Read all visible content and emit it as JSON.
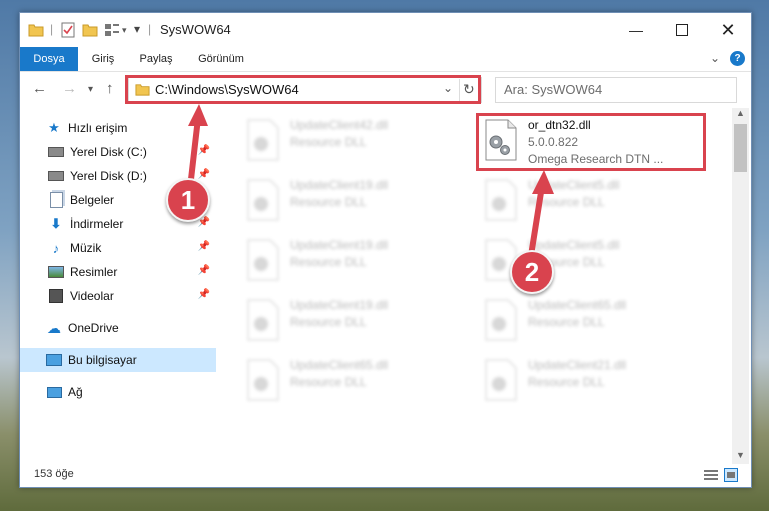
{
  "window": {
    "title": "SysWOW64"
  },
  "ribbon": {
    "tabs": [
      "Dosya",
      "Giriş",
      "Paylaş",
      "Görünüm"
    ]
  },
  "address": {
    "path": "C:\\Windows\\SysWOW64",
    "search_placeholder": "Ara: SysWOW64"
  },
  "sidebar": {
    "quick_access": "Hızlı erişim",
    "items": [
      "Yerel Disk (C:)",
      "Yerel Disk (D:)",
      "Belgeler",
      "İndirmeler",
      "Müzik",
      "Resimler",
      "Videolar"
    ],
    "onedrive": "OneDrive",
    "this_pc": "Bu bilgisayar",
    "network": "Ağ"
  },
  "files": {
    "highlight": {
      "name": "or_dtn32.dll",
      "version": "5.0.0.822",
      "desc": "Omega Research DTN ..."
    },
    "left": [
      {
        "name": "UpdateClient42.dll",
        "type": "Resource DLL"
      },
      {
        "name": "UpdateClient19.dll",
        "type": "Resource DLL"
      },
      {
        "name": "UpdateClient19.dll",
        "type": "Resource DLL"
      },
      {
        "name": "UpdateClient19.dll",
        "type": "Resource DLL"
      },
      {
        "name": "UpdateClient65.dll",
        "type": "Resource DLL"
      }
    ],
    "right": [
      {
        "name": "UpdateClient5.dll",
        "type": "Resource DLL"
      },
      {
        "name": "UpdateClient5.dll",
        "type": "Resource DLL"
      },
      {
        "name": "UpdateClient65.dll",
        "type": "Resource DLL"
      },
      {
        "name": "UpdateClient21.dll",
        "type": "Resource DLL"
      }
    ]
  },
  "status": {
    "count": "153 öğe"
  },
  "annotations": {
    "one": "1",
    "two": "2"
  },
  "colors": {
    "accent": "#1979ca",
    "annotation": "#d9434e",
    "selection": "#cce8ff"
  }
}
